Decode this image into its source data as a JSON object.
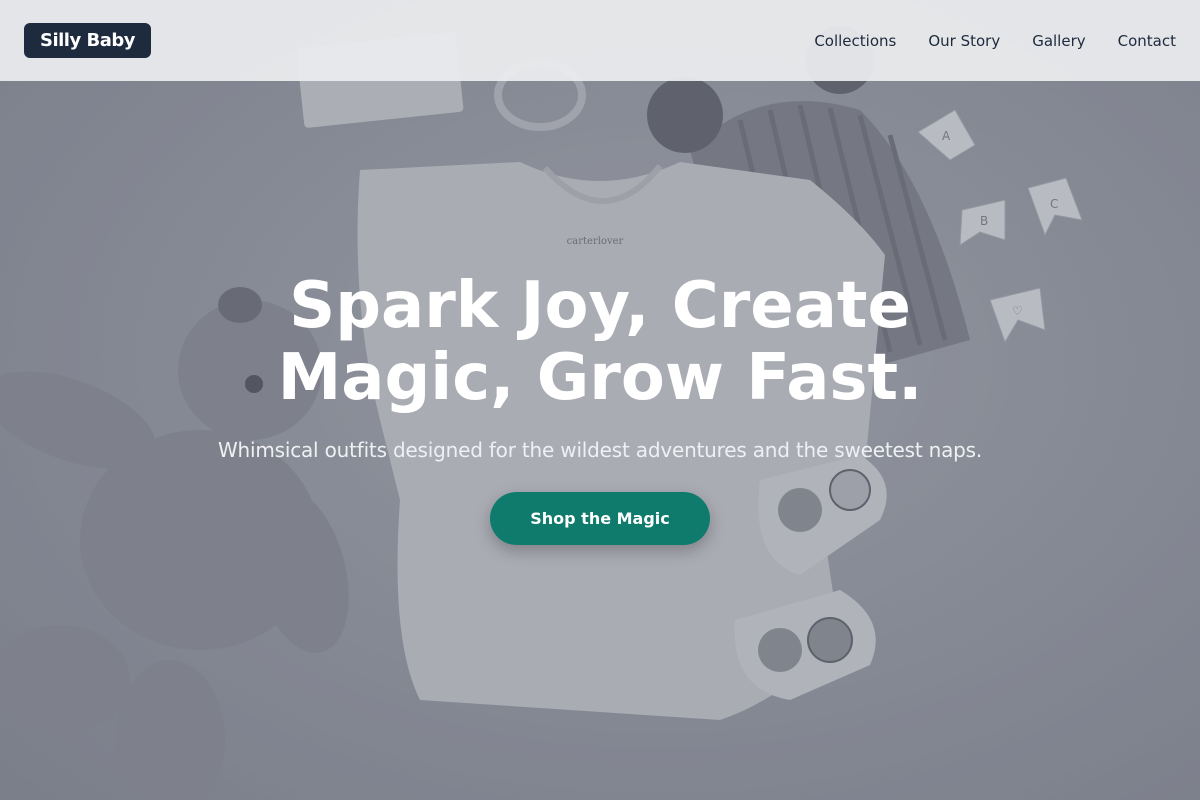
{
  "brand": {
    "logo_text": "Silly Baby"
  },
  "nav": {
    "items": [
      {
        "label": "Collections"
      },
      {
        "label": "Our Story"
      },
      {
        "label": "Gallery"
      },
      {
        "label": "Contact"
      }
    ]
  },
  "hero": {
    "title_line1": "Spark Joy, Create",
    "title_line2": "Magic, Grow Fast.",
    "subtitle": "Whimsical outfits designed for the wildest adventures and the sweetest naps.",
    "cta_label": "Shop the Magic",
    "tshirt_tag": "carterlover",
    "bunting_letters": [
      "A",
      "B",
      "C",
      "♡"
    ]
  },
  "colors": {
    "header_bg": "#ecedef",
    "logo_bg": "#1e2a3d",
    "nav_text": "#1e2a3d",
    "cta_bg": "#0f7b6c",
    "hero_text": "#ffffff"
  }
}
